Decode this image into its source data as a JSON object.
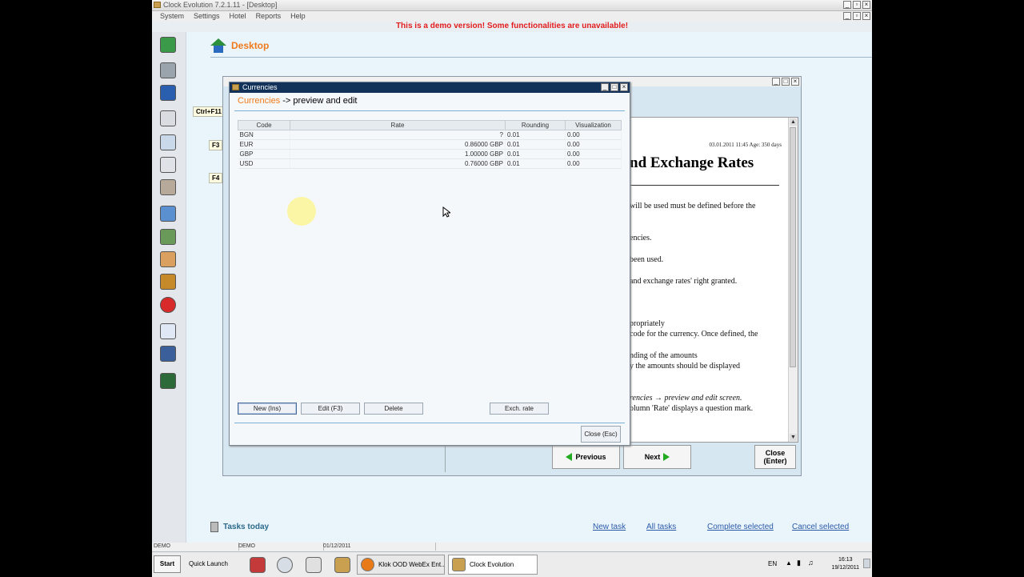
{
  "app": {
    "title": "Clock Evolution 7.2.1.11 - [Desktop]",
    "menu": [
      "System",
      "Settings",
      "Hotel",
      "Reports",
      "Help"
    ],
    "demo_notice": "This is a demo version! Some functionalities are unavailable!"
  },
  "desktop": {
    "title": "Desktop",
    "shortcuts": [
      "Ctrl+F11",
      "F3",
      "F4"
    ]
  },
  "help_window": {
    "date_line": "03.01.2011 11:45  Age: 350 days",
    "heading": "nd Exchange Rates",
    "lines": [
      "will be used must be defined before the",
      "encies.",
      "been used.",
      "and exchange rates' right granted.",
      "propriately",
      "code for the currency. Once defined, the",
      "nding of the amounts",
      "y the amounts should be displayed",
      "rencies → preview and edit screen.",
      "olumn 'Rate' displays a question mark."
    ],
    "buttons": {
      "previous": "Previous",
      "next": "Next",
      "close": "Close",
      "close_sub": "(Enter)"
    }
  },
  "currencies_window": {
    "title": "Currencies",
    "header_highlight": "Currencies",
    "header_rest": " -> preview and edit",
    "columns": [
      "Code",
      "Rate",
      "Rounding",
      "Visualization"
    ],
    "rows": [
      {
        "code": "BGN",
        "rate": "?",
        "rounding": "0.01",
        "visualization": "0.00"
      },
      {
        "code": "EUR",
        "rate": "0.86000 GBP",
        "rounding": "0.01",
        "visualization": "0.00"
      },
      {
        "code": "GBP",
        "rate": "1.00000 GBP",
        "rounding": "0.01",
        "visualization": "0.00"
      },
      {
        "code": "USD",
        "rate": "0.76000 GBP",
        "rounding": "0.01",
        "visualization": "0.00"
      }
    ],
    "buttons": {
      "new": "New (Ins)",
      "edit": "Edit (F3)",
      "delete": "Delete",
      "exch_rate": "Exch. rate",
      "close": "Close (Esc)"
    }
  },
  "tasks": {
    "title": "Tasks today",
    "links": [
      "New task",
      "All tasks",
      "Complete selected",
      "Cancel selected"
    ]
  },
  "status_bar": [
    "DEMO",
    "DEMO",
    "01/12/2011"
  ],
  "taskbar": {
    "start": "Start",
    "quick_launch": "Quick Launch",
    "tasks": [
      "Klok OOD WebEx Ent...",
      "Clock Evolution"
    ],
    "lang": "EN",
    "time": "16:13",
    "date": "19/12/2011"
  }
}
